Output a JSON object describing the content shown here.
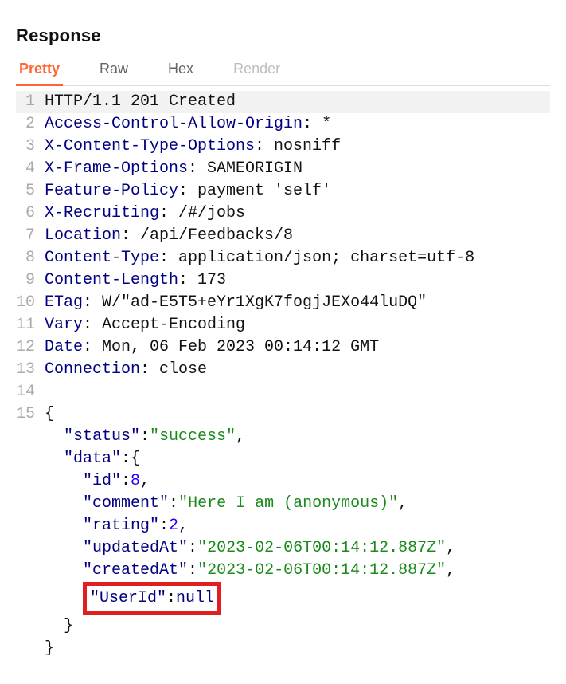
{
  "panel": {
    "title": "Response"
  },
  "tabs": [
    {
      "label": "Pretty",
      "active": true,
      "dim": false
    },
    {
      "label": "Raw",
      "active": false,
      "dim": false
    },
    {
      "label": "Hex",
      "active": false,
      "dim": false
    },
    {
      "label": "Render",
      "active": false,
      "dim": true
    }
  ],
  "lines": [
    {
      "n": "1",
      "hl": true,
      "seg": [
        {
          "c": "pl",
          "t": "HTTP/1.1 201 Created"
        }
      ]
    },
    {
      "n": "2",
      "seg": [
        {
          "c": "hn",
          "t": "Access-Control-Allow-Origin"
        },
        {
          "c": "pl",
          "t": ": *"
        }
      ]
    },
    {
      "n": "3",
      "seg": [
        {
          "c": "hn",
          "t": "X-Content-Type-Options"
        },
        {
          "c": "pl",
          "t": ": nosniff"
        }
      ]
    },
    {
      "n": "4",
      "seg": [
        {
          "c": "hn",
          "t": "X-Frame-Options"
        },
        {
          "c": "pl",
          "t": ": SAMEORIGIN"
        }
      ]
    },
    {
      "n": "5",
      "seg": [
        {
          "c": "hn",
          "t": "Feature-Policy"
        },
        {
          "c": "pl",
          "t": ": payment 'self'"
        }
      ]
    },
    {
      "n": "6",
      "seg": [
        {
          "c": "hn",
          "t": "X-Recruiting"
        },
        {
          "c": "pl",
          "t": ": /#/jobs"
        }
      ]
    },
    {
      "n": "7",
      "seg": [
        {
          "c": "hn",
          "t": "Location"
        },
        {
          "c": "pl",
          "t": ": /api/Feedbacks/8"
        }
      ]
    },
    {
      "n": "8",
      "seg": [
        {
          "c": "hn",
          "t": "Content-Type"
        },
        {
          "c": "pl",
          "t": ": application/json; charset=utf-8"
        }
      ]
    },
    {
      "n": "9",
      "seg": [
        {
          "c": "hn",
          "t": "Content-Length"
        },
        {
          "c": "pl",
          "t": ": 173"
        }
      ]
    },
    {
      "n": "10",
      "seg": [
        {
          "c": "hn",
          "t": "ETag"
        },
        {
          "c": "pl",
          "t": ": W/\"ad-E5T5+eYr1XgK7fogjJEXo44luDQ\""
        }
      ]
    },
    {
      "n": "11",
      "seg": [
        {
          "c": "hn",
          "t": "Vary"
        },
        {
          "c": "pl",
          "t": ": Accept-Encoding"
        }
      ]
    },
    {
      "n": "12",
      "seg": [
        {
          "c": "hn",
          "t": "Date"
        },
        {
          "c": "pl",
          "t": ": Mon, 06 Feb 2023 00:14:12 GMT"
        }
      ]
    },
    {
      "n": "13",
      "seg": [
        {
          "c": "hn",
          "t": "Connection"
        },
        {
          "c": "pl",
          "t": ": close"
        }
      ]
    },
    {
      "n": "14",
      "seg": [
        {
          "c": "pl",
          "t": " "
        }
      ]
    },
    {
      "n": "15",
      "seg": [
        {
          "c": "pl",
          "t": "{"
        }
      ]
    },
    {
      "n": "",
      "seg": [
        {
          "c": "pl",
          "t": "  "
        },
        {
          "c": "hn",
          "t": "\"status\""
        },
        {
          "c": "pl",
          "t": ":"
        },
        {
          "c": "sv",
          "t": "\"success\""
        },
        {
          "c": "pl",
          "t": ","
        }
      ]
    },
    {
      "n": "",
      "seg": [
        {
          "c": "pl",
          "t": "  "
        },
        {
          "c": "hn",
          "t": "\"data\""
        },
        {
          "c": "pl",
          "t": ":{"
        }
      ]
    },
    {
      "n": "",
      "seg": [
        {
          "c": "pl",
          "t": "    "
        },
        {
          "c": "hn",
          "t": "\"id\""
        },
        {
          "c": "pl",
          "t": ":"
        },
        {
          "c": "nv",
          "t": "8"
        },
        {
          "c": "pl",
          "t": ","
        }
      ]
    },
    {
      "n": "",
      "seg": [
        {
          "c": "pl",
          "t": "    "
        },
        {
          "c": "hn",
          "t": "\"comment\""
        },
        {
          "c": "pl",
          "t": ":"
        },
        {
          "c": "sv",
          "t": "\"Here I am (anonymous)\""
        },
        {
          "c": "pl",
          "t": ","
        }
      ]
    },
    {
      "n": "",
      "seg": [
        {
          "c": "pl",
          "t": "    "
        },
        {
          "c": "hn",
          "t": "\"rating\""
        },
        {
          "c": "pl",
          "t": ":"
        },
        {
          "c": "nv",
          "t": "2"
        },
        {
          "c": "pl",
          "t": ","
        }
      ]
    },
    {
      "n": "",
      "seg": [
        {
          "c": "pl",
          "t": "    "
        },
        {
          "c": "hn",
          "t": "\"updatedAt\""
        },
        {
          "c": "pl",
          "t": ":"
        },
        {
          "c": "sv",
          "t": "\"2023-02-06T00:14:12.887Z\""
        },
        {
          "c": "pl",
          "t": ","
        }
      ]
    },
    {
      "n": "",
      "seg": [
        {
          "c": "pl",
          "t": "    "
        },
        {
          "c": "hn",
          "t": "\"createdAt\""
        },
        {
          "c": "pl",
          "t": ":"
        },
        {
          "c": "sv",
          "t": "\"2023-02-06T00:14:12.887Z\""
        },
        {
          "c": "pl",
          "t": ","
        }
      ]
    },
    {
      "n": "",
      "box": true,
      "seg": [
        {
          "c": "pl",
          "t": "    "
        },
        {
          "c": "hn",
          "t": "\"UserId\""
        },
        {
          "c": "pl",
          "t": ":"
        },
        {
          "c": "hn",
          "t": "null"
        }
      ]
    },
    {
      "n": "",
      "seg": [
        {
          "c": "pl",
          "t": "  }"
        }
      ]
    },
    {
      "n": "",
      "seg": [
        {
          "c": "pl",
          "t": "}"
        }
      ]
    }
  ]
}
